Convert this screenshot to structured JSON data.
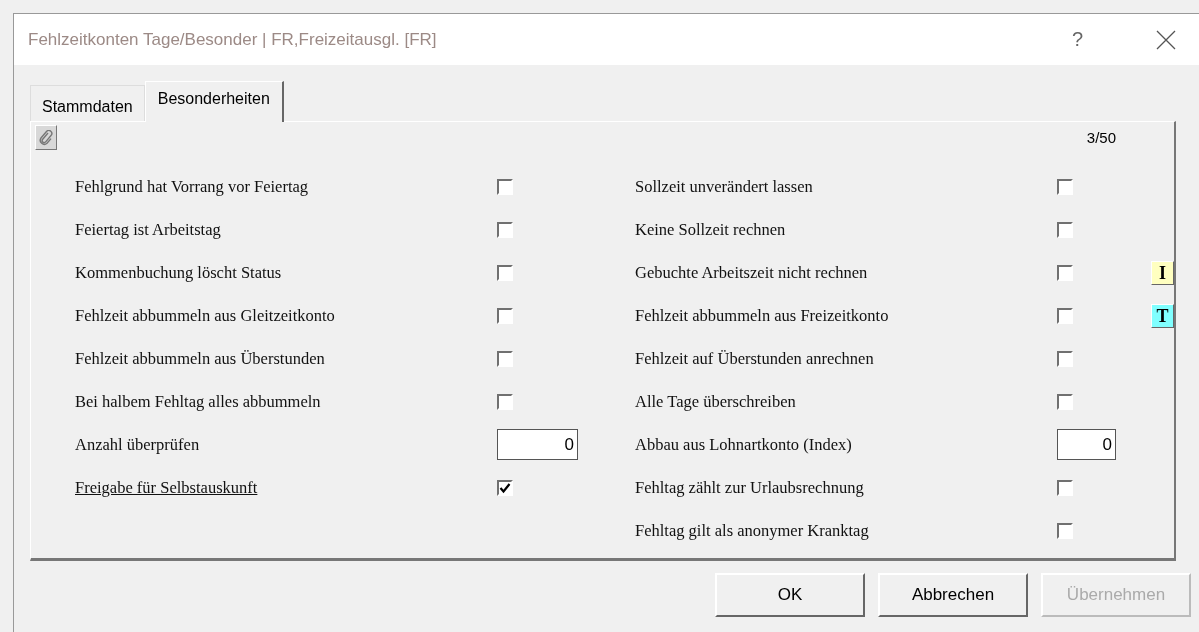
{
  "window": {
    "title": "Fehlzeitkonten Tage/Besonder | FR,Freizeitausgl. [FR]",
    "help": "?"
  },
  "tabs": [
    {
      "label": "Stammdaten",
      "selected": false
    },
    {
      "label": "Besonderheiten",
      "selected": true
    }
  ],
  "counter": "3/50",
  "left": [
    {
      "kind": "checkbox",
      "label": "Fehlgrund hat Vorrang vor Feiertag",
      "checked": false
    },
    {
      "kind": "checkbox",
      "label": "Feiertag ist Arbeitstag",
      "checked": false
    },
    {
      "kind": "checkbox",
      "label": "Kommenbuchung löscht Status",
      "checked": false
    },
    {
      "kind": "checkbox",
      "label": "Fehlzeit abbummeln aus Gleitzeitkonto",
      "checked": false
    },
    {
      "kind": "checkbox",
      "label": "Fehlzeit abbummeln aus Überstunden",
      "checked": false
    },
    {
      "kind": "checkbox",
      "label": "Bei halbem Fehltag alles abbummeln",
      "checked": false
    },
    {
      "kind": "number",
      "label": "Anzahl überprüfen",
      "value": "0"
    },
    {
      "kind": "checkbox",
      "label": "Freigabe für Selbstauskunft",
      "checked": true,
      "link": true
    }
  ],
  "right": [
    {
      "kind": "checkbox",
      "label": "Sollzeit unverändert lassen",
      "checked": false
    },
    {
      "kind": "checkbox",
      "label": "Keine Sollzeit rechnen",
      "checked": false
    },
    {
      "kind": "checkbox",
      "label": "Gebuchte Arbeitszeit nicht rechnen",
      "checked": false,
      "button": {
        "label": "I",
        "color": "#ffffc0"
      }
    },
    {
      "kind": "checkbox",
      "label": "Fehlzeit abbummeln aus Freizeitkonto",
      "checked": false,
      "button": {
        "label": "T",
        "color": "#80ffff"
      }
    },
    {
      "kind": "checkbox",
      "label": "Fehlzeit auf Überstunden anrechnen",
      "checked": false
    },
    {
      "kind": "checkbox",
      "label": "Alle Tage überschreiben",
      "checked": false
    },
    {
      "kind": "number",
      "label": "Abbau aus Lohnartkonto (Index)",
      "value": "0"
    },
    {
      "kind": "checkbox",
      "label": "Fehltag zählt zur Urlaubsrechnung",
      "checked": false
    },
    {
      "kind": "checkbox",
      "label": "Fehltag gilt als anonymer Kranktag",
      "checked": false
    }
  ],
  "buttons": [
    {
      "label": "OK",
      "disabled": false
    },
    {
      "label": "Abbrechen",
      "disabled": false
    },
    {
      "label": "Übernehmen",
      "disabled": true
    }
  ]
}
